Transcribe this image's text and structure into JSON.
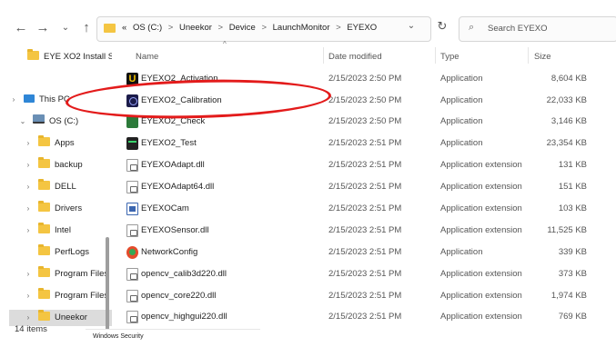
{
  "address": {
    "crumbs": [
      "OS (C:)",
      "Uneekor",
      "Device",
      "LaunchMonitor",
      "EYEXO"
    ],
    "separator": ">",
    "overflow": "«"
  },
  "search": {
    "placeholder": "Search EYEXO"
  },
  "nav": {
    "quick_access_item": "EYE XO2 Install S",
    "items": [
      {
        "label": "This PC",
        "kind": "pc"
      },
      {
        "label": "OS (C:)",
        "kind": "drive"
      },
      {
        "label": "Apps",
        "kind": "folder"
      },
      {
        "label": "backup",
        "kind": "folder"
      },
      {
        "label": "DELL",
        "kind": "folder"
      },
      {
        "label": "Drivers",
        "kind": "folder"
      },
      {
        "label": "Intel",
        "kind": "folder"
      },
      {
        "label": "PerfLogs",
        "kind": "folder"
      },
      {
        "label": "Program Files",
        "kind": "folder"
      },
      {
        "label": "Program Files",
        "kind": "folder"
      },
      {
        "label": "Uneekor",
        "kind": "folder",
        "selected": true
      }
    ]
  },
  "columns": {
    "name": "Name",
    "date": "Date modified",
    "type": "Type",
    "size": "Size"
  },
  "files": [
    {
      "name": "EYEXO2_Activation",
      "date": "2/15/2023 2:50 PM",
      "type": "Application",
      "size": "8,604 KB",
      "icon": "uneekor-u-icon"
    },
    {
      "name": "EYEXO2_Calibration",
      "date": "2/15/2023 2:50 PM",
      "type": "Application",
      "size": "22,033 KB",
      "icon": "calibration-app-icon"
    },
    {
      "name": "EYEXO2_Check",
      "date": "2/15/2023 2:50 PM",
      "type": "Application",
      "size": "3,146 KB",
      "icon": "check-app-icon"
    },
    {
      "name": "EYEXO2_Test",
      "date": "2/15/2023 2:51 PM",
      "type": "Application",
      "size": "23,354 KB",
      "icon": "test-app-icon"
    },
    {
      "name": "EYEXOAdapt.dll",
      "date": "2/15/2023 2:51 PM",
      "type": "Application extension",
      "size": "131 KB",
      "icon": "dll-file-icon"
    },
    {
      "name": "EYEXOAdapt64.dll",
      "date": "2/15/2023 2:51 PM",
      "type": "Application extension",
      "size": "151 KB",
      "icon": "dll-file-icon"
    },
    {
      "name": "EYEXOCam",
      "date": "2/15/2023 2:51 PM",
      "type": "Application extension",
      "size": "103 KB",
      "icon": "camera-file-icon"
    },
    {
      "name": "EYEXOSensor.dll",
      "date": "2/15/2023 2:51 PM",
      "type": "Application extension",
      "size": "11,525 KB",
      "icon": "dll-file-icon"
    },
    {
      "name": "NetworkConfig",
      "date": "2/15/2023 2:51 PM",
      "type": "Application",
      "size": "339 KB",
      "icon": "network-app-icon"
    },
    {
      "name": "opencv_calib3d220.dll",
      "date": "2/15/2023 2:51 PM",
      "type": "Application extension",
      "size": "373 KB",
      "icon": "dll-file-icon"
    },
    {
      "name": "opencv_core220.dll",
      "date": "2/15/2023 2:51 PM",
      "type": "Application extension",
      "size": "1,974 KB",
      "icon": "dll-file-icon"
    },
    {
      "name": "opencv_highgui220.dll",
      "date": "2/15/2023 2:51 PM",
      "type": "Application extension",
      "size": "769 KB",
      "icon": "dll-file-icon"
    }
  ],
  "status": {
    "item_count": "14 items"
  },
  "taskbar": {
    "label": "Windows Security"
  },
  "colors": {
    "annotation": "#e31b1b",
    "folder": "#f4c542"
  }
}
